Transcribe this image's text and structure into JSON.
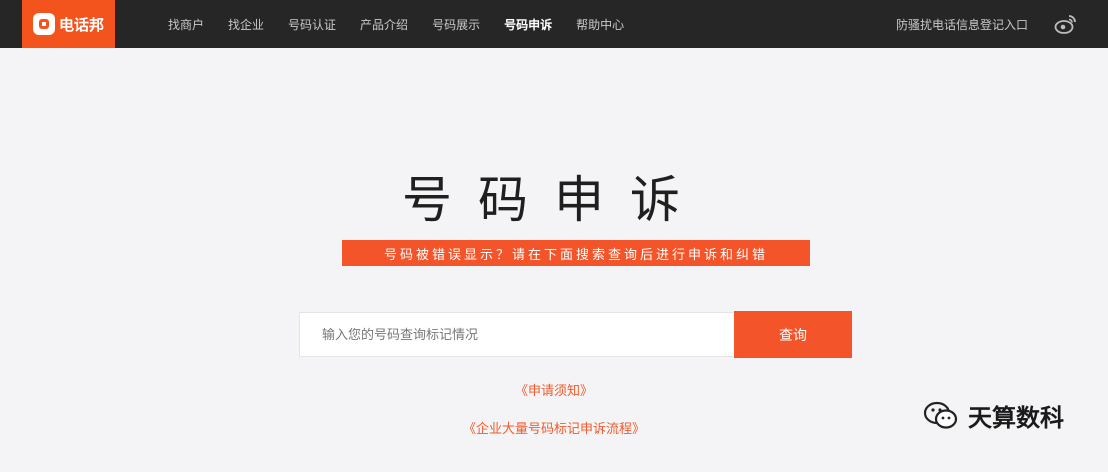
{
  "header": {
    "logo_text": "电话邦",
    "nav": [
      {
        "label": "找商户",
        "active": false
      },
      {
        "label": "找企业",
        "active": false
      },
      {
        "label": "号码认证",
        "active": false
      },
      {
        "label": "产品介绍",
        "active": false
      },
      {
        "label": "号码展示",
        "active": false
      },
      {
        "label": "号码申诉",
        "active": true
      },
      {
        "label": "帮助中心",
        "active": false
      }
    ],
    "right_link": "防骚扰电话信息登记入口",
    "social_icon": "weibo-icon"
  },
  "main": {
    "title": "号码申诉",
    "subtitle": "号码被错误显示？请在下面搜索查询后进行申诉和纠错",
    "search": {
      "placeholder": "输入您的号码查询标记情况",
      "value": "",
      "button_label": "查询"
    },
    "links": [
      "《申请须知》",
      "《企业大量号码标记申诉流程》"
    ]
  },
  "watermark": {
    "text": "天算数科",
    "icon": "wechat-icon"
  },
  "colors": {
    "accent": "#f3541e",
    "topbar": "#262626",
    "background": "#f4f4f6"
  }
}
